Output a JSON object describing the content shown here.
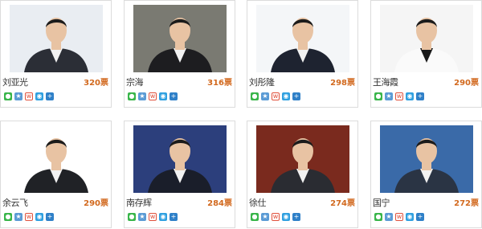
{
  "vote_unit": "票",
  "share_icons": [
    "wechat-icon",
    "qzone-icon",
    "weibo-icon",
    "tencent-weibo-icon",
    "more-share-icon"
  ],
  "colors": {
    "votes": "#d2691e",
    "card_border": "#dcdcdc"
  },
  "cards": [
    {
      "name": "刘亚光",
      "votes": "320票",
      "photo_bg": "#e9edf2",
      "suit": "#2b2e36"
    },
    {
      "name": "宗海",
      "votes": "316票",
      "photo_bg": "#7a7a72",
      "suit": "#1d1d20"
    },
    {
      "name": "刘彤隆",
      "votes": "298票",
      "photo_bg": "#f4f6f8",
      "suit": "#1e2330"
    },
    {
      "name": "王海霞",
      "votes": "290票",
      "photo_bg": "#f5f5f5",
      "suit": "#fafafa"
    },
    {
      "name": "余云飞",
      "votes": "290票",
      "photo_bg": "#ffffff",
      "suit": "#202226"
    },
    {
      "name": "南存辉",
      "votes": "284票",
      "photo_bg": "#2c3f7c",
      "suit": "#1a1e2a"
    },
    {
      "name": "徐仕",
      "votes": "274票",
      "photo_bg": "#7a2a1e",
      "suit": "#2a2c32"
    },
    {
      "name": "国宁",
      "votes": "272票",
      "photo_bg": "#3a6aa8",
      "suit": "#2a3444"
    }
  ]
}
